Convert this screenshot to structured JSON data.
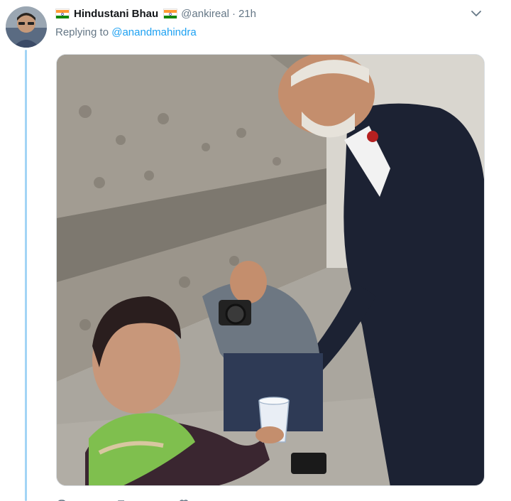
{
  "tweet": {
    "author_name": "Hindustani Bhau",
    "handle": "@ankireal",
    "separator": "·",
    "timestamp": "21h",
    "replying_prefix": "Replying to",
    "replying_to": "@anandmahindra"
  },
  "media": {
    "kind": "photo",
    "description_icon": "photo-icon"
  },
  "icons": {
    "flag": "indian-flag-icon",
    "caret": "chevron-down-icon",
    "reply": "reply-icon",
    "retweet": "retweet-icon",
    "like": "like-icon",
    "share": "share-icon"
  },
  "colors": {
    "accent": "#1da1f2",
    "thread_line": "#a2d4f5",
    "muted_text": "#657786",
    "primary_text": "#14171a"
  }
}
